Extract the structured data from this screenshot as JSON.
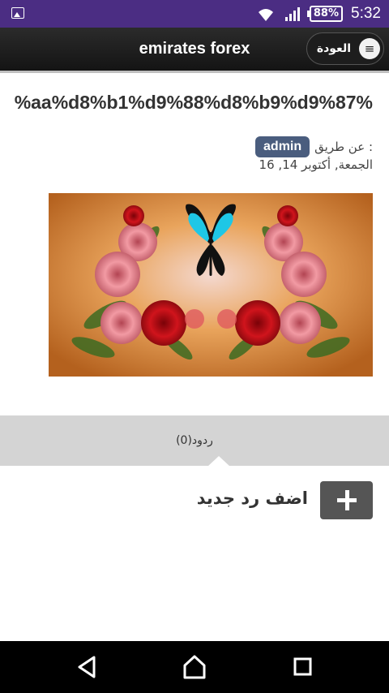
{
  "status_bar": {
    "battery": "88%",
    "time": "5:32",
    "icons": [
      "image-notification-icon",
      "wifi-icon",
      "signal-icon",
      "battery-icon"
    ]
  },
  "app_bar": {
    "title": "emirates forex",
    "back_label": "العودة",
    "menu_icon": "menu-icon"
  },
  "post": {
    "title": "%aa%d8%b1%d9%88%d8%b9%d9%87%",
    "byline_prefix": ": عن طريق",
    "author": "admin",
    "date": "الجمعة, أكتوبر 14, 16"
  },
  "replies": {
    "count_label": "(0)ردود",
    "add_reply_label": "اضف رد جديد"
  },
  "nav_bar": {
    "icons": [
      "back-triangle-icon",
      "home-icon",
      "recents-icon"
    ]
  }
}
